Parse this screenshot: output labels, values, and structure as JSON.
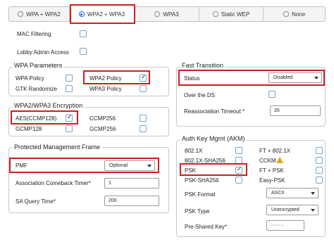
{
  "security_modes": {
    "options": [
      "WPA + WPA2",
      "WPA2 + WPA3",
      "WPA3",
      "Static WEP",
      "None"
    ],
    "selected": "WPA2 + WPA3"
  },
  "general": {
    "mac_filtering": {
      "label": "MAC Filtering",
      "checked": false
    },
    "lobby_admin_access": {
      "label": "Lobby Admin Access",
      "checked": false
    }
  },
  "wpa_parameters": {
    "title": "WPA Parameters",
    "wpa_policy": {
      "label": "WPA Policy",
      "checked": false
    },
    "wpa2_policy": {
      "label": "WPA2 Policy",
      "checked": true
    },
    "gtk_randomize": {
      "label": "GTK Randomize",
      "checked": false
    },
    "wpa3_policy": {
      "label": "WPA3 Policy",
      "checked": false
    }
  },
  "encryption": {
    "title": "WPA2/WPA3 Encryption",
    "aes_ccmp128": {
      "label": "AES(CCMP128)",
      "checked": true
    },
    "ccmp256": {
      "label": "CCMP256",
      "checked": false
    },
    "gcmp128": {
      "label": "GCMP128",
      "checked": false
    },
    "gcmp256": {
      "label": "GCMP256",
      "checked": false
    }
  },
  "pmf": {
    "title": "Protected Management Frame",
    "pmf_label": "PMF",
    "pmf_value": "Optional",
    "comeback_label": "Association Comeback Timer*",
    "comeback_value": "1",
    "sa_query_label": "SA Query Time*",
    "sa_query_value": "200"
  },
  "fast_transition": {
    "title": "Fast Transition",
    "status_label": "Status",
    "status_value": "Disabled",
    "over_ds": {
      "label": "Over the DS",
      "checked": false
    },
    "reassoc_label": "Reassociation Timeout *",
    "reassoc_value": "20"
  },
  "akm": {
    "title": "Auth Key Mgmt (AKM)",
    "dot1x": {
      "label": "802.1X",
      "checked": false
    },
    "ft_dot1x": {
      "label": "FT + 802.1X",
      "checked": false
    },
    "dot1x_sha256": {
      "label": "802.1X-SHA256",
      "checked": false
    },
    "cckm": {
      "label": "CCKM",
      "checked": false
    },
    "psk": {
      "label": "PSK",
      "checked": true
    },
    "ft_psk": {
      "label": "FT + PSK",
      "checked": false
    },
    "psk_sha256": {
      "label": "PSK-SHA256",
      "checked": false
    },
    "easy_psk": {
      "label": "Easy-PSK",
      "checked": false
    },
    "psk_format_label": "PSK Format",
    "psk_format_value": "ASCII",
    "psk_type_label": "PSK Type",
    "psk_type_value": "Unencrypted",
    "preshared_label": "Pre-Shared Key*",
    "preshared_value": "········"
  },
  "colors": {
    "highlight": "#cc1f1f",
    "accent": "#1a73c8",
    "warning": "#e8a21a"
  }
}
